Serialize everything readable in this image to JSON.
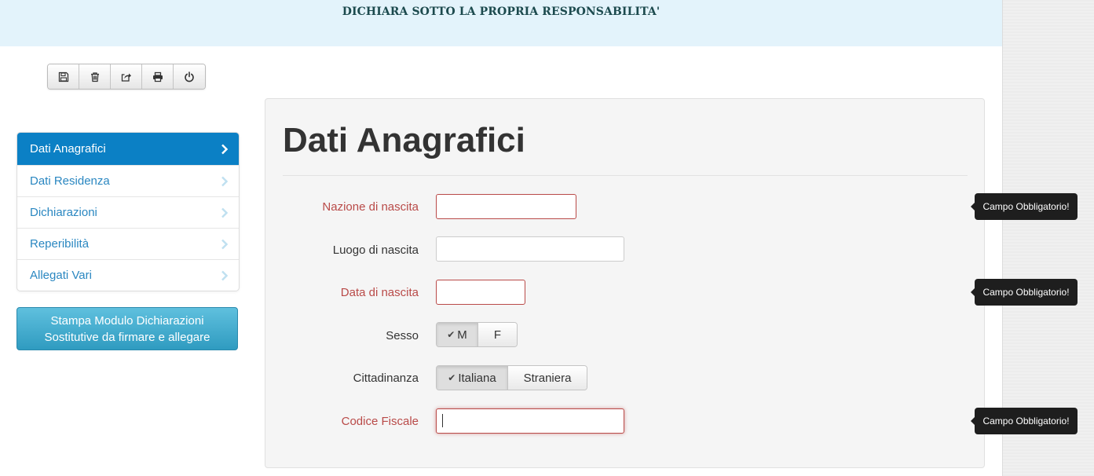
{
  "header": {
    "banner_text": "DICHIARA SOTTO LA PROPRIA RESPONSABILITA'"
  },
  "toolbar": {
    "buttons": [
      {
        "icon": "save-icon"
      },
      {
        "icon": "trash-icon"
      },
      {
        "icon": "share-icon"
      },
      {
        "icon": "print-icon"
      },
      {
        "icon": "power-icon"
      }
    ]
  },
  "sidebar": {
    "items": [
      {
        "label": "Dati Anagrafici",
        "active": true
      },
      {
        "label": "Dati Residenza",
        "active": false
      },
      {
        "label": "Dichiarazioni",
        "active": false
      },
      {
        "label": "Reperibilità",
        "active": false
      },
      {
        "label": "Allegati Vari",
        "active": false
      }
    ],
    "print_button": {
      "line1": "Stampa Modulo Dichiarazioni",
      "line2": "Sostitutive da firmare e allegare"
    }
  },
  "form": {
    "title": "Dati Anagrafici",
    "fields": {
      "nazione": {
        "label": "Nazione di nascita",
        "value": ""
      },
      "luogo": {
        "label": "Luogo di nascita",
        "value": ""
      },
      "data": {
        "label": "Data di nascita",
        "value": ""
      },
      "sesso": {
        "label": "Sesso",
        "options": [
          "M",
          "F"
        ],
        "selected": "M"
      },
      "cittadinanza": {
        "label": "Cittadinanza",
        "options": [
          "Italiana",
          "Straniera"
        ],
        "selected": "Italiana"
      },
      "codice_fiscale": {
        "label": "Codice Fiscale",
        "value": ""
      }
    }
  },
  "tooltips": {
    "nazione": "Campo Obbligatorio!",
    "data": "Campo Obbligatorio!",
    "codice_fiscale": "Campo Obbligatorio!"
  },
  "colors": {
    "accent": "#0b80c5",
    "error": "#b94a48",
    "info_button": "#3aa6cc",
    "banner_bg": "#e3f3fb"
  }
}
